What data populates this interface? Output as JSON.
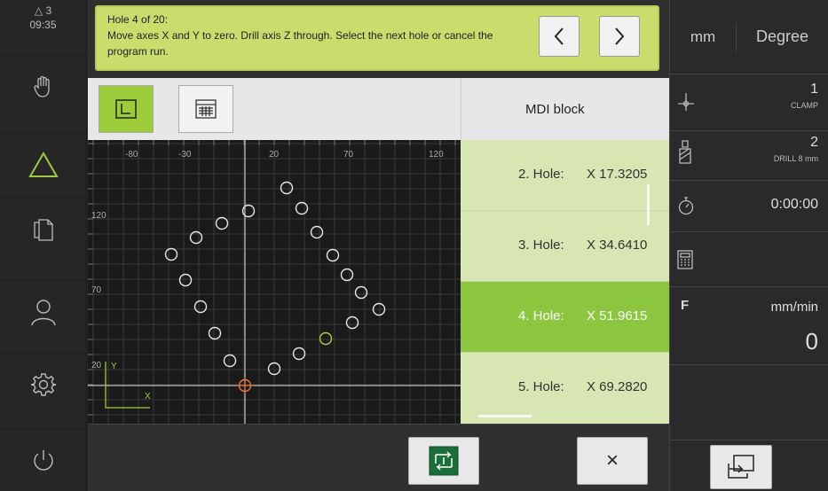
{
  "sidebar": {
    "status_count": "3",
    "status_time": "09:35",
    "items": [
      {
        "icon": "hand-icon"
      },
      {
        "icon": "triangle-icon"
      },
      {
        "icon": "files-icon"
      },
      {
        "icon": "user-icon"
      },
      {
        "icon": "gear-icon"
      },
      {
        "icon": "power-icon"
      }
    ]
  },
  "message": {
    "line1": "Hole 4 of 20:",
    "line2": "Move axes X and Y to zero. Drill axis Z through. Select the next hole or cancel the program run.",
    "prev_label": "‹",
    "next_label": "›"
  },
  "toolbar": {
    "view_graphic_icon": "axis-view-icon",
    "view_table_icon": "table-view-icon"
  },
  "plot": {
    "x_ticks": [
      "-80",
      "-30",
      "20",
      "70",
      "120"
    ],
    "y_ticks": [
      "120",
      "70",
      "20"
    ],
    "axis_y_label": "Y",
    "axis_x_label": "X"
  },
  "mdi": {
    "header": "MDI block",
    "rows": [
      {
        "label": "2. Hole:",
        "value": "X 17.3205"
      },
      {
        "label": "3. Hole:",
        "value": "X 34.6410"
      },
      {
        "label": "4. Hole:",
        "value": "X 51.9615"
      },
      {
        "label": "5. Hole:",
        "value": "X 69.2820"
      }
    ],
    "active_index": 2
  },
  "bottombar": {
    "run_icon": "program-run-icon",
    "close_label": "×"
  },
  "right_panel": {
    "unit_length": "mm",
    "unit_angle": "Degree",
    "clamp_value": "1",
    "clamp_label": "CLAMP",
    "tool_value": "2",
    "tool_label": "DRILL 8 mm",
    "timer": "0:00:00",
    "feed_label": "F",
    "feed_unit": "mm/min",
    "feed_value": "0"
  },
  "colors": {
    "accent_green": "#8cc63f",
    "message_bg": "#c9dd6c",
    "hole_current": "#b8c94a",
    "hole_origin": "#e87a4a"
  }
}
